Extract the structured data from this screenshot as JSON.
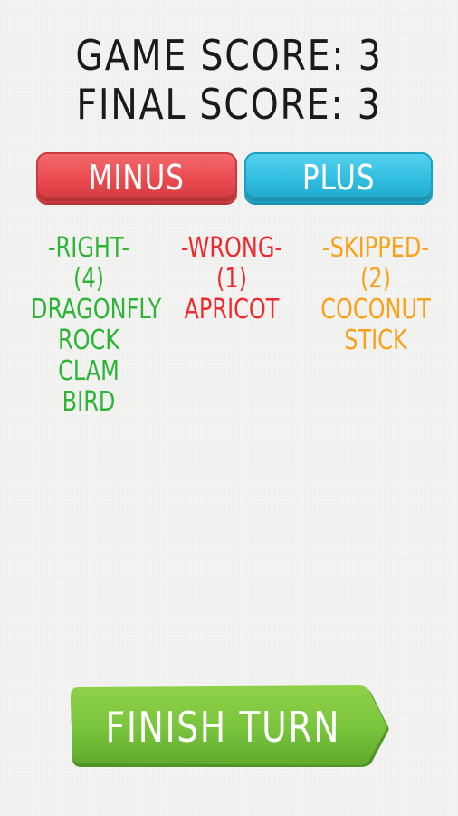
{
  "scores": {
    "game_score_label": "GAME SCORE: 3",
    "final_score_label": "FINAL SCORE: 3"
  },
  "controls": {
    "minus_label": "MINUS",
    "plus_label": "PLUS",
    "finish_label": "FINISH TURN"
  },
  "results": {
    "right": {
      "header": "-RIGHT-",
      "count": "(4)",
      "words": [
        "DRAGONFLY",
        "ROCK",
        "CLAM",
        "BIRD"
      ]
    },
    "wrong": {
      "header": "-WRONG-",
      "count": "(1)",
      "words": [
        "APRICOT"
      ]
    },
    "skipped": {
      "header": "-SKIPPED-",
      "count": "(2)",
      "words": [
        "COCONUT",
        "STICK"
      ]
    }
  },
  "colors": {
    "right": "#2db436",
    "wrong": "#ef2a2f",
    "skipped": "#f6a21a",
    "minus_button": "#ea4a4f",
    "plus_button": "#30bde0",
    "finish_button": "#78c43c"
  }
}
